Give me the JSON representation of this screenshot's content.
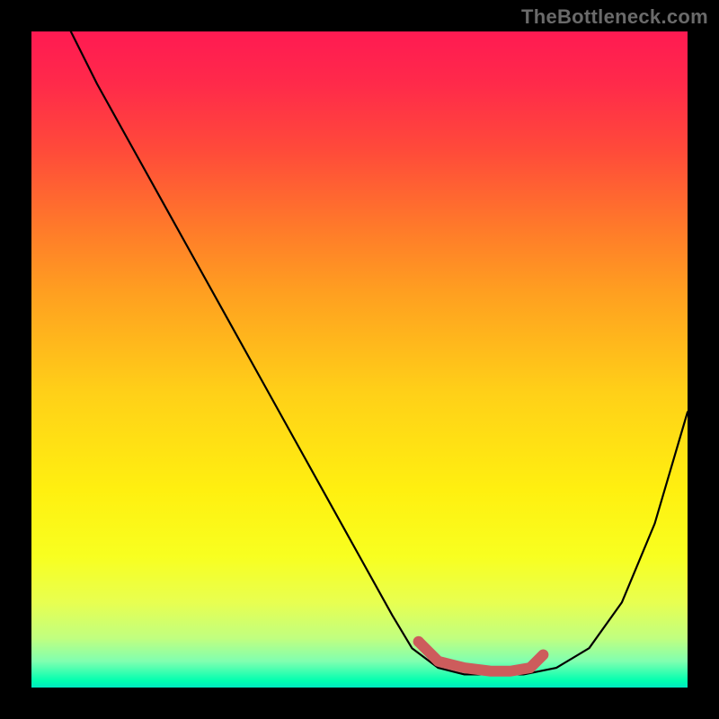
{
  "watermark": "TheBottleneck.com",
  "chart_data": {
    "type": "line",
    "title": "",
    "xlabel": "",
    "ylabel": "",
    "xlim": [
      0,
      100
    ],
    "ylim": [
      0,
      100
    ],
    "grid": false,
    "legend": false,
    "background_gradient": {
      "orientation": "vertical",
      "stops": [
        {
          "pos": 0.0,
          "color": "#ff1a52"
        },
        {
          "pos": 0.08,
          "color": "#ff2a4a"
        },
        {
          "pos": 0.18,
          "color": "#ff4a3a"
        },
        {
          "pos": 0.3,
          "color": "#ff7a2a"
        },
        {
          "pos": 0.4,
          "color": "#ffa020"
        },
        {
          "pos": 0.55,
          "color": "#ffd018"
        },
        {
          "pos": 0.7,
          "color": "#fff010"
        },
        {
          "pos": 0.8,
          "color": "#f8ff20"
        },
        {
          "pos": 0.87,
          "color": "#e8ff50"
        },
        {
          "pos": 0.925,
          "color": "#c0ff80"
        },
        {
          "pos": 0.96,
          "color": "#80ffb0"
        },
        {
          "pos": 0.99,
          "color": "#00ffb0"
        },
        {
          "pos": 1.0,
          "color": "#00e8c0"
        }
      ]
    },
    "series": [
      {
        "name": "bottleneck-curve",
        "color": "#000000",
        "x": [
          6,
          10,
          15,
          20,
          25,
          30,
          35,
          40,
          45,
          50,
          55,
          58,
          62,
          66,
          70,
          75,
          80,
          85,
          90,
          95,
          100
        ],
        "y": [
          100,
          92,
          83,
          74,
          65,
          56,
          47,
          38,
          29,
          20,
          11,
          6,
          3,
          2,
          2,
          2,
          3,
          6,
          13,
          25,
          42
        ]
      },
      {
        "name": "optimal-range",
        "color": "#cd5c5c",
        "x": [
          59,
          62,
          66,
          70,
          73,
          76,
          78
        ],
        "y": [
          7,
          4,
          3,
          2.5,
          2.5,
          3,
          5
        ]
      }
    ],
    "markers": [
      {
        "name": "optimal-start-dot",
        "x": 59,
        "y": 7,
        "color": "#cd5c5c",
        "size": 6
      }
    ]
  }
}
